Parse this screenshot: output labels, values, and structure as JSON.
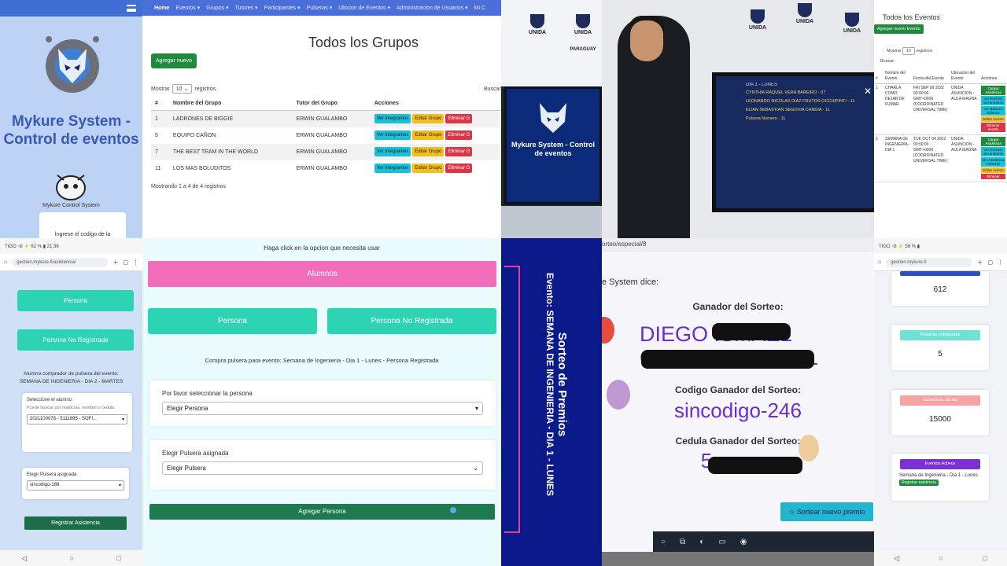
{
  "admin_sidebar": {
    "title": "Mykure System - Control de eventos",
    "small_logo_caption": "Mykure Control System",
    "code_prompt": "Ingrese el codigo de la"
  },
  "groups_page": {
    "nav": [
      "Home",
      "Eventos ▾",
      "Grupos ▾",
      "Tutores ▾",
      "Participantes ▾",
      "Pulseras ▾",
      "Ubicion de Eventos ▾",
      "Administracion de Usuarios ▾",
      "Mi C"
    ],
    "title": "Todos los Grupos",
    "add_button": "Agregar nuevo",
    "show_prefix": "Mostrar",
    "show_value": "10 ⌄",
    "show_suffix": "registros",
    "search_label": "Buscar",
    "headers": [
      "#",
      "Nombre del Grupo",
      "Tutor del Grupo",
      "Acciones"
    ],
    "rows": [
      {
        "id": "1",
        "name": "LADRONES DE BIGGIE",
        "tutor": "ERWIN GUALAMBO"
      },
      {
        "id": "5",
        "name": "EQUIPO CAÑON",
        "tutor": "ERWIN GUALAMBO"
      },
      {
        "id": "7",
        "name": "THE BEST TEAM IN THE WORLD",
        "tutor": "ERWIN GUALAMBO"
      },
      {
        "id": "11",
        "name": "LOS MAS BOLUDITOS",
        "tutor": "ERWIN GUALAMBO"
      }
    ],
    "actions": {
      "members": "Ver Integrantes",
      "edit": "Editar Grupo",
      "delete": "Eliminar G"
    },
    "footer": "Mostrando 1 a 4 de 4 registros"
  },
  "photo_tv": {
    "brand": "UNIDA",
    "brand_sub": "PARAGUAY",
    "screen_title": "Mykure System - Control de eventos"
  },
  "photo_person": {
    "screen_header": "DIA 1 - LUNES",
    "winners": [
      "CYNTHIA RAQUEL VERA BAREIRO - 07",
      "LEONARDO NICOLAS DIAZ FRUTOS OCCHIPINTI - 11",
      "ELIAN SEBASTIAN SEGOVIA CANDIA - 11",
      "Pulsera Numero - 11"
    ]
  },
  "events_page": {
    "title": "Todos los Eventos",
    "add_button": "Agregar nuevo Evento",
    "show_prefix": "Mostrar",
    "show_value": "10",
    "show_suffix": "registros",
    "search_label": "Buscar:",
    "headers": [
      "#",
      "Nombre del Evento",
      "Fecha del Evento",
      "Ubicacion del Evento",
      "Acciones"
    ],
    "rows": [
      {
        "id": "1",
        "name": "CHARLA COMO DEJAR DE FUMAR",
        "date": "FRI SEP 09 2022 00:00:00 GMT+0000 (COORDINATED UNIVERSAL TIME)",
        "place": "UNIDA ASUNCION - AULA MAGNA"
      },
      {
        "id": "2",
        "name": "SEMANA DE INGENIERIA - DIA 1",
        "date": "TUE OCT 04 2022 00:00:00 GMT+0000 (COORDINATED UNIVERSAL TIME)",
        "place": "UNIDA ASUNCION - AULA MAGNA"
      }
    ],
    "row1_actions": [
      "Cargar Asistencia",
      "Ver Eventos Secundarios",
      "Ver Balance Balance",
      "Editar evento",
      "Eliminar evento"
    ],
    "row2_actions": [
      "Cargar Asistencia",
      "Ver Eventos Secundarios",
      "Ver Asistencia Pulseras",
      "Editar evento",
      "Eliminar"
    ]
  },
  "mobile_attendance": {
    "status": "TIGO ⋅ıll ⚡ 62 % ▮ 21:36",
    "url": "gestion.mykure.fi/asistencia/",
    "btn_persona": "Persona",
    "btn_no_registrada": "Persona No Registrada",
    "info_line1": "Alumno comprador de pulsera del evento:",
    "info_line2": "SEMANA DE INGENIERIA - DIA 2 - MARTES",
    "select_label": "Seleccione el alumno",
    "select_hint": "Puede buscar por matricula, nombre o cedula",
    "select_value": "2021100078 - 5111895 - SOFI...",
    "pulsera_label": "Elegir Pulsera asignada",
    "pulsera_value": "sincodigo-188",
    "submit": "Registrar Asistencia"
  },
  "desktop_form": {
    "prompt": "Haga click en la opcion que necesita usar",
    "btn_alumnos": "Alumnos",
    "btn_persona": "Persona",
    "btn_no_registrada": "Persona No Registrada",
    "context": "Compra pulsera para evento: Semana de Ingenieria - Dia 1 - Lunes - Persona Registrada",
    "person_label": "Por favor seleccionar la persona",
    "person_value": "Elegir Persona",
    "pulsera_label": "Elegir Pulsera asignada",
    "pulsera_value": "Elegir Pulsera",
    "submit": "Agregar Persona"
  },
  "raffle_banner": {
    "title": "Sorteo de Premios",
    "subtitle": "Evento: SEMANA DE INGENIERIA - DIA 1 - LUNES"
  },
  "raffle_screen": {
    "url": "orteo/especial/8",
    "dialog": "e System dice:",
    "winner_label": "Ganador del Sorteo:",
    "winner_line1": "DIEGO ISMAEL",
    "winner_line2": "CUBILLA CABRAL",
    "code_label": "Codigo Ganador del Sorteo:",
    "code_value": "sincodigo-246",
    "id_label": "Cedula Ganador del Sorteo:",
    "id_value": "5",
    "button": "☆ Sortear nuevo premio"
  },
  "mobile_stats": {
    "status": "TIGO ⋅ıll ⚡ 58 % ▮",
    "url": "gestion.mykure.fi",
    "card1_value": "612",
    "card2_label": "Pulseras entregadas",
    "card2_value": "5",
    "card3_label": "Ganancias del dia",
    "card3_value": "15000",
    "card4_label": "Eventos Activos",
    "card4_event": "Semana de Ingenieria - Dia 1 - Lunes",
    "card4_button": "Registrar asistencia"
  },
  "colors": {
    "nav_blue": "#4b6fd8",
    "title_blue": "#3b58b8",
    "teal": "#2dd4b4",
    "pink": "#f26ebd",
    "green": "#1d7a4c",
    "raffle_purple": "#6a2ed0"
  }
}
